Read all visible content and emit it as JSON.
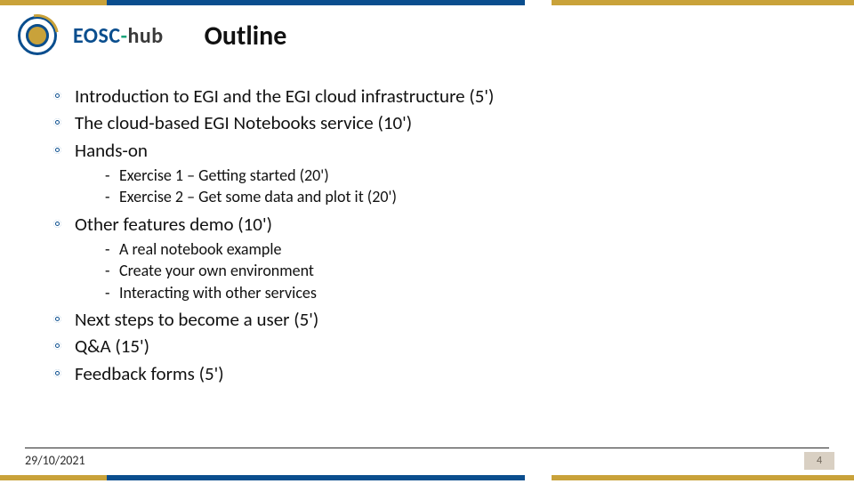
{
  "brand": {
    "left": "EOSC",
    "dash": "-",
    "right": "hub"
  },
  "title": "Outline",
  "outline": {
    "items": [
      {
        "text": "Introduction to EGI and the EGI cloud infrastructure (5')"
      },
      {
        "text": "The cloud-based EGI Notebooks service (10')"
      },
      {
        "text": "Hands-on",
        "sub": [
          "Exercise 1 – Getting started (20')",
          "Exercise 2 – Get some data and plot it (20')"
        ]
      },
      {
        "text": "Other features demo (10')",
        "sub": [
          "A real notebook example",
          "Create your own environment",
          "Interacting with other services"
        ]
      },
      {
        "text": "Next steps to become a user (5')"
      },
      {
        "text": "Q&A (15')"
      },
      {
        "text": "Feedback forms (5')"
      }
    ]
  },
  "footer": {
    "date": "29/10/2021",
    "page": "4"
  }
}
